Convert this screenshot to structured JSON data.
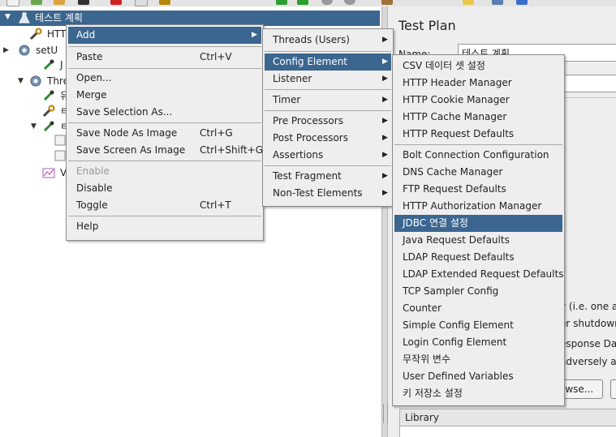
{
  "colors": {
    "selection": "#3b6690",
    "menu_bg": "#eeeeee",
    "tree_bg": "#ffffff"
  },
  "tree": {
    "root_label": "테스트 계획",
    "rows": [
      {
        "label": "HTT",
        "icon": "wrench-icon"
      },
      {
        "label": "setU",
        "icon": "gear-icon"
      },
      {
        "label": "J",
        "icon": "pipette-icon"
      },
      {
        "label": "Thre",
        "icon": "gear-icon"
      },
      {
        "label": "유",
        "icon": "pipette-icon"
      },
      {
        "label": "ㅌ",
        "icon": "wrench-icon"
      },
      {
        "label": "ㅌ",
        "icon": "pipette-icon"
      },
      {
        "label": "V",
        "icon": "chart-icon"
      }
    ]
  },
  "right_panel": {
    "title": "Test Plan",
    "name_label": "Name:",
    "name_value": "테스트 계획",
    "text_fragments": [
      "y (i.e. one at",
      "er shutdown",
      "esponse Da",
      "adversely aff"
    ],
    "browse_label": "owse...",
    "library_label": "Library"
  },
  "context_menu": {
    "items": [
      {
        "label": "Add",
        "submenu": true,
        "selected": true
      },
      {
        "separator": true
      },
      {
        "label": "Paste",
        "shortcut": "Ctrl+V"
      },
      {
        "separator": true
      },
      {
        "label": "Open..."
      },
      {
        "label": "Merge"
      },
      {
        "label": "Save Selection As..."
      },
      {
        "separator": true
      },
      {
        "label": "Save Node As Image",
        "shortcut": "Ctrl+G"
      },
      {
        "label": "Save Screen As Image",
        "shortcut": "Ctrl+Shift+G"
      },
      {
        "separator": true
      },
      {
        "label": "Enable",
        "disabled": true
      },
      {
        "label": "Disable"
      },
      {
        "label": "Toggle",
        "shortcut": "Ctrl+T"
      },
      {
        "separator": true
      },
      {
        "label": "Help"
      }
    ]
  },
  "add_submenu": {
    "items": [
      {
        "label": "Threads (Users)",
        "submenu": true
      },
      {
        "separator": true
      },
      {
        "label": "Config Element",
        "submenu": true,
        "selected": true
      },
      {
        "label": "Listener",
        "submenu": true
      },
      {
        "separator": true
      },
      {
        "label": "Timer",
        "submenu": true
      },
      {
        "separator": true
      },
      {
        "label": "Pre Processors",
        "submenu": true
      },
      {
        "label": "Post Processors",
        "submenu": true
      },
      {
        "label": "Assertions",
        "submenu": true
      },
      {
        "separator": true
      },
      {
        "label": "Test Fragment",
        "submenu": true
      },
      {
        "label": "Non-Test Elements",
        "submenu": true
      }
    ]
  },
  "config_submenu": {
    "items": [
      {
        "label": "CSV 데이터 셋 설정"
      },
      {
        "label": "HTTP Header Manager"
      },
      {
        "label": "HTTP Cookie Manager"
      },
      {
        "label": "HTTP Cache Manager"
      },
      {
        "label": "HTTP Request Defaults"
      },
      {
        "separator": true
      },
      {
        "label": "Bolt Connection Configuration"
      },
      {
        "label": "DNS Cache Manager"
      },
      {
        "label": "FTP Request Defaults"
      },
      {
        "label": "HTTP Authorization Manager"
      },
      {
        "label": "JDBC 연결 설정",
        "selected": true
      },
      {
        "label": "Java Request Defaults"
      },
      {
        "label": "LDAP Request Defaults"
      },
      {
        "label": "LDAP Extended Request Defaults"
      },
      {
        "label": "TCP Sampler Config"
      },
      {
        "label": "Counter"
      },
      {
        "label": "Simple Config Element"
      },
      {
        "label": "Login Config Element"
      },
      {
        "label": "무작위 변수"
      },
      {
        "label": "User Defined Variables"
      },
      {
        "label": "키 저장소 설정"
      }
    ]
  }
}
